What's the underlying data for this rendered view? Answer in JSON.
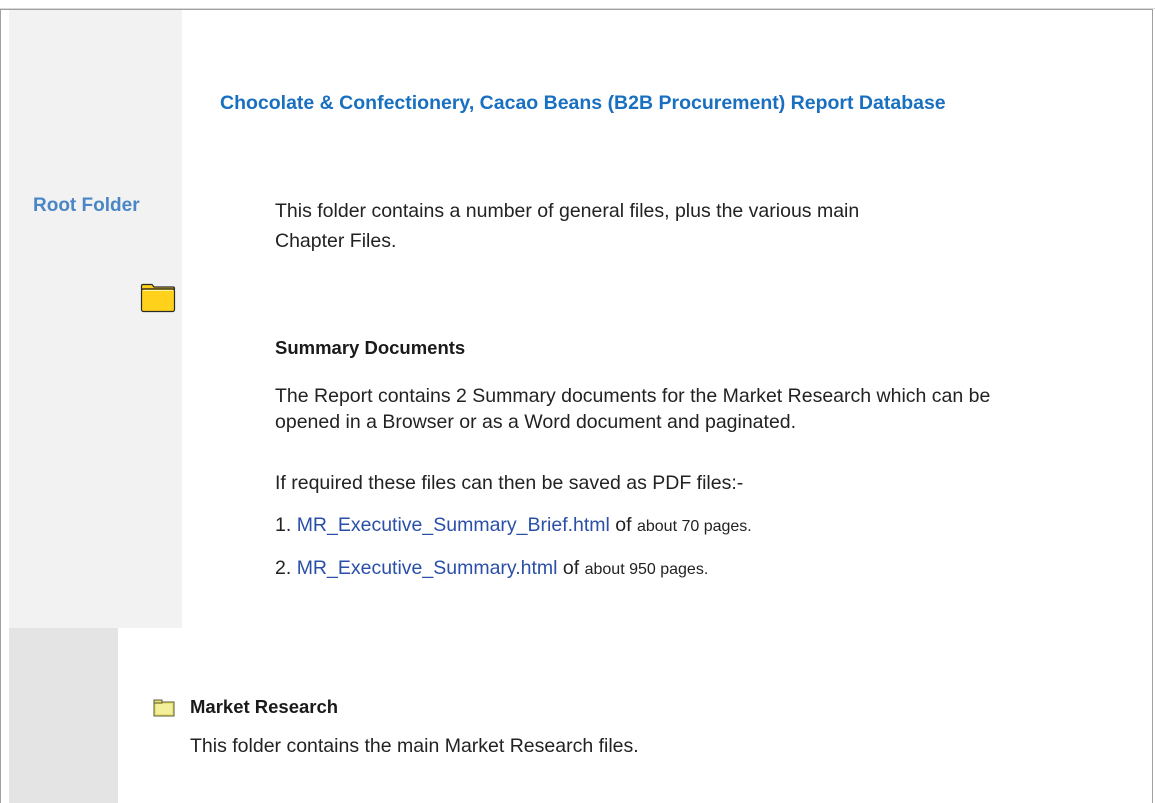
{
  "root_folder": {
    "label": "Root Folder",
    "icon": "folder-icon"
  },
  "report": {
    "title": "Chocolate & Confectionery, Cacao Beans (B2B Procurement) Report Database",
    "intro": "This folder contains a number of general files, plus the various main Chapter Files."
  },
  "summary": {
    "heading": "Summary Documents",
    "body": "The Report contains 2 Summary documents for the Market Research which can be opened in a Browser or as a Word document and paginated.",
    "pdf_note": "If required these files can then be saved as PDF files:-",
    "documents": [
      {
        "number": "1.",
        "name": "MR_Executive_Summary_Brief.html",
        "suffix_of": "of",
        "suffix_pages": "about 70 pages."
      },
      {
        "number": "2.",
        "name": "MR_Executive_Summary.html",
        "suffix_of": "of",
        "suffix_pages": "about 950 pages."
      }
    ]
  },
  "market_research": {
    "icon": "folder-icon",
    "heading": "Market Research",
    "description": "This folder contains the main Market Research files."
  },
  "colors": {
    "root_label": "#4a86c6",
    "title": "#1a70c0",
    "link": "#2a4fa8",
    "folder_fill": "#ffd11a",
    "folder_small_fill": "#e8e070",
    "left_panel": "#f2f2f2",
    "bottom_panel": "#e4e4e4"
  }
}
